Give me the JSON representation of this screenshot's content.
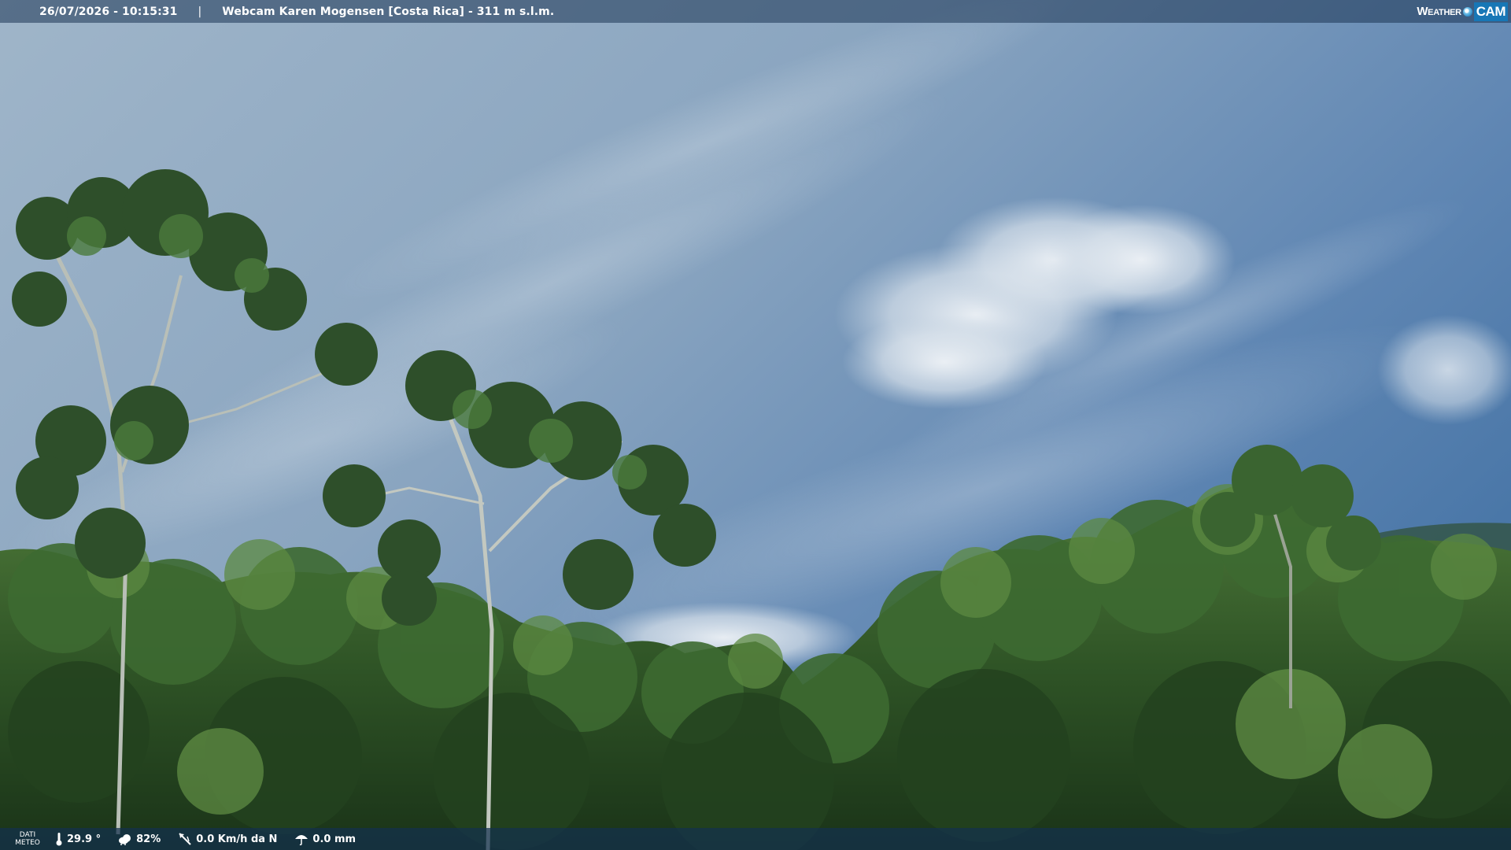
{
  "header": {
    "datetime": "26/07/2026 - 10:15:31",
    "separator": "|",
    "location": "Webcam Karen Mogensen [Costa Rica] - 311 m s.l.m."
  },
  "brand": {
    "name_part1": "Weather",
    "name_part2": "CAM"
  },
  "footer": {
    "label_line1": "DATI",
    "label_line2": "METEO",
    "temperature": "29.9 °",
    "humidity": "82%",
    "wind": "0.0 Km/h da N",
    "rain": "0.0 mm"
  },
  "colors": {
    "sky_top": "#4e7aa8",
    "sky_mid": "#8fa9c1",
    "cloud": "#dfe6ee",
    "forest_dark": "#1f3b1f",
    "forest_mid": "#3f6a32",
    "forest_light": "#6c9a4a",
    "brand_blue": "#1877b6"
  }
}
